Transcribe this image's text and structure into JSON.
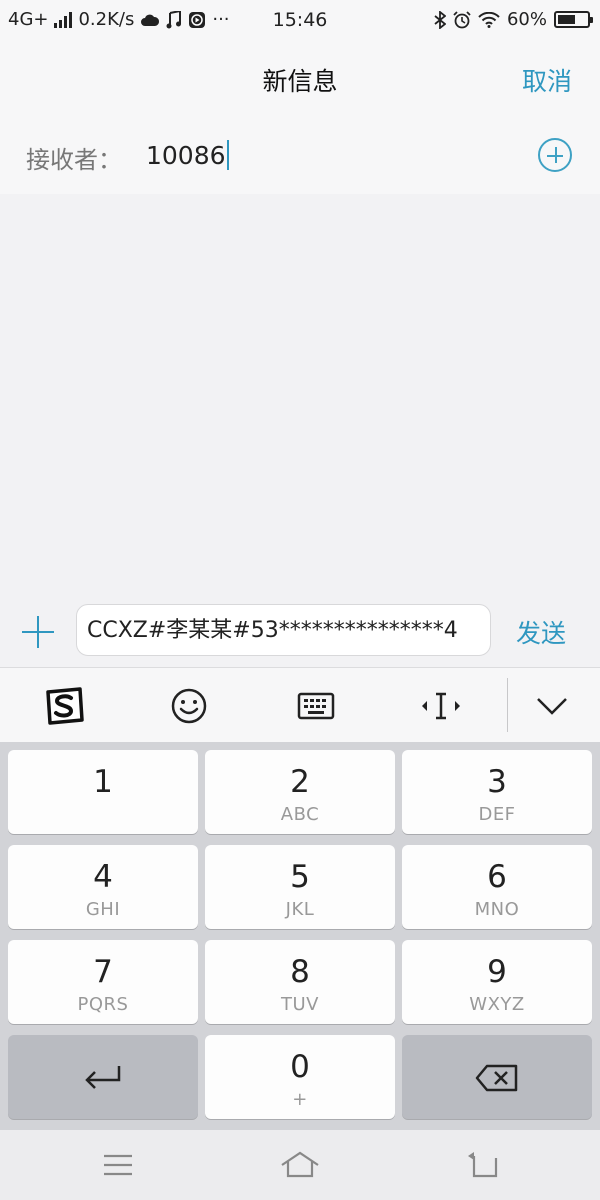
{
  "status_bar": {
    "network": "4G+",
    "speed": "0.2K/s",
    "overflow": "···",
    "time": "15:46",
    "battery_text": "60%",
    "battery_level": 0.6,
    "icons": [
      "signal-icon",
      "weather-icon",
      "music-icon",
      "media-icon",
      "bluetooth-icon",
      "alarm-icon",
      "wifi-icon",
      "battery-icon"
    ]
  },
  "header": {
    "title": "新信息",
    "cancel_label": "取消"
  },
  "recipient": {
    "label": "接收者：",
    "value": "10086"
  },
  "compose": {
    "message": "CCXZ#李某某#53***************4",
    "send_label": "发送"
  },
  "keyboard_toolbar": {
    "tools": [
      "sogou-logo-icon",
      "emoji-icon",
      "keyboard-icon",
      "cursor-move-icon",
      "collapse-keyboard-icon"
    ]
  },
  "keypad": {
    "keys": [
      {
        "digit": "1",
        "letters": ""
      },
      {
        "digit": "2",
        "letters": "ABC"
      },
      {
        "digit": "3",
        "letters": "DEF"
      },
      {
        "digit": "4",
        "letters": "GHI"
      },
      {
        "digit": "5",
        "letters": "JKL"
      },
      {
        "digit": "6",
        "letters": "MNO"
      },
      {
        "digit": "7",
        "letters": "PQRS"
      },
      {
        "digit": "8",
        "letters": "TUV"
      },
      {
        "digit": "9",
        "letters": "WXYZ"
      },
      {
        "digit": "0",
        "letters": "+"
      }
    ]
  },
  "colors": {
    "accent": "#2f97c0",
    "keyboard_bg": "#d2d3d7",
    "key_bg": "#fdfdfd",
    "func_key_bg": "#b9bbc1"
  },
  "nav_bar": {
    "buttons": [
      "menu-icon",
      "home-icon",
      "back-icon"
    ]
  }
}
